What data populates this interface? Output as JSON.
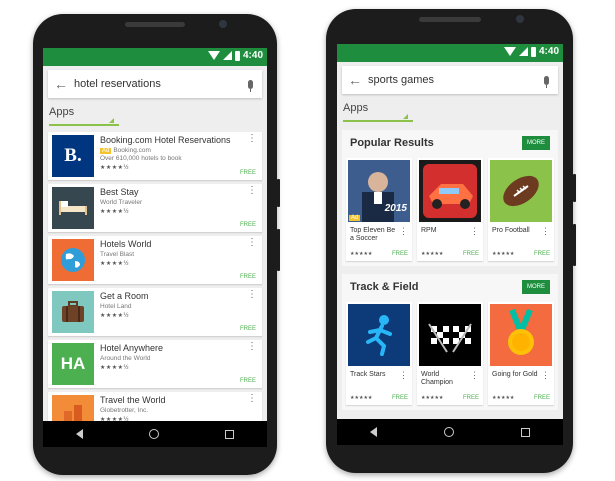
{
  "status_bar": {
    "time": "4:40"
  },
  "left_phone": {
    "search": {
      "query": "hotel reservations"
    },
    "section_label": "Apps",
    "apps": [
      {
        "title": "Booking.com Hotel Reservations",
        "ad_label": "Ad",
        "developer": "Booking.com",
        "description": "Over 610,000 hotels to book",
        "stars": "★★★★½",
        "price": "FREE",
        "icon": "booking-b-icon",
        "color": "#003580",
        "letter": "B."
      },
      {
        "title": "Best Stay",
        "developer": "World Traveler",
        "stars": "★★★★½",
        "price": "FREE",
        "icon": "bed-icon",
        "color": "#37474f"
      },
      {
        "title": "Hotels World",
        "developer": "Travel Blast",
        "stars": "★★★★½",
        "price": "FREE",
        "icon": "globe-icon",
        "color": "#ef6c35"
      },
      {
        "title": "Get a Room",
        "developer": "Hotel Land",
        "stars": "★★★★½",
        "price": "FREE",
        "icon": "suitcase-icon",
        "color": "#7ec8c0"
      },
      {
        "title": "Hotel Anywhere",
        "developer": "Around the World",
        "stars": "★★★★½",
        "price": "FREE",
        "icon": "ha-icon",
        "color": "#4caf50",
        "letter": "HA"
      },
      {
        "title": "Travel the World",
        "developer": "Globetrotter, Inc.",
        "stars": "★★★★½",
        "icon": "buildings-icon",
        "color": "#f28c38"
      }
    ]
  },
  "right_phone": {
    "search": {
      "query": "sports games"
    },
    "section_label": "Apps",
    "sections": [
      {
        "title": "Popular Results",
        "more_label": "MORE",
        "games": [
          {
            "name": "Top Eleven Be a Soccer",
            "ad_label": "Ad",
            "thumb_text": "2015",
            "stars": "★★★★★",
            "price": "FREE",
            "icon": "soccer-manager-icon",
            "color": "#2c4a7a"
          },
          {
            "name": "RPM",
            "stars": "★★★★★",
            "price": "FREE",
            "icon": "race-car-icon",
            "color": "#c62828"
          },
          {
            "name": "Pro Football",
            "stars": "★★★★★",
            "price": "FREE",
            "icon": "football-icon",
            "color": "#8bc34a"
          }
        ]
      },
      {
        "title": "Track & Field",
        "more_label": "MORE",
        "games": [
          {
            "name": "Track Stars",
            "stars": "★★★★★",
            "price": "FREE",
            "icon": "runner-icon",
            "color": "#0d3b7a"
          },
          {
            "name": "World Champion",
            "stars": "★★★★★",
            "price": "FREE",
            "icon": "checkered-flags-icon",
            "color": "#000000"
          },
          {
            "name": "Going for Gold",
            "stars": "★★★★★",
            "price": "FREE",
            "icon": "gold-medal-icon",
            "color": "#f36b3f"
          }
        ]
      }
    ]
  }
}
